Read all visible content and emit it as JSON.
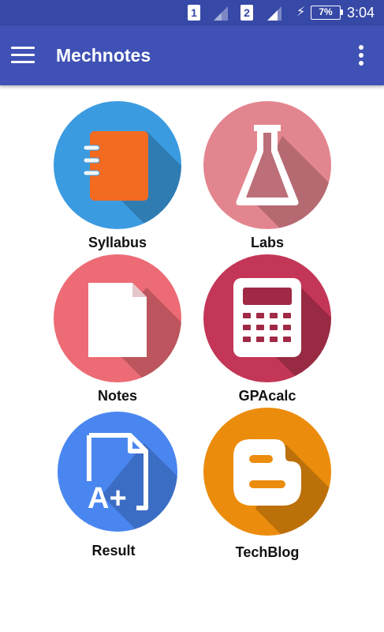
{
  "status_bar": {
    "sim1": "1",
    "sim2": "2",
    "battery": "7%",
    "time": "3:04",
    "icons": [
      "sim-card-icon",
      "signal-icon",
      "charging-icon",
      "battery-icon"
    ]
  },
  "app_bar": {
    "title": "Mechnotes",
    "menu_icon": "hamburger-menu-icon",
    "overflow_icon": "more-vert-icon",
    "color": "#3f51b5",
    "status_color": "#3749a6"
  },
  "tiles": [
    {
      "label": "Syllabus",
      "icon": "notebook-icon",
      "color": "#3b9be0"
    },
    {
      "label": "Labs",
      "icon": "flask-icon",
      "color": "#e3858f"
    },
    {
      "label": "Notes",
      "icon": "document-icon",
      "color": "#ec6b75"
    },
    {
      "label": "GPAcalc",
      "icon": "calculator-icon",
      "color": "#c33657"
    },
    {
      "label": "Result",
      "icon": "grade-document-icon",
      "color": "#4a86ef"
    },
    {
      "label": "TechBlog",
      "icon": "blogger-icon",
      "color": "#ec8c0d"
    }
  ]
}
